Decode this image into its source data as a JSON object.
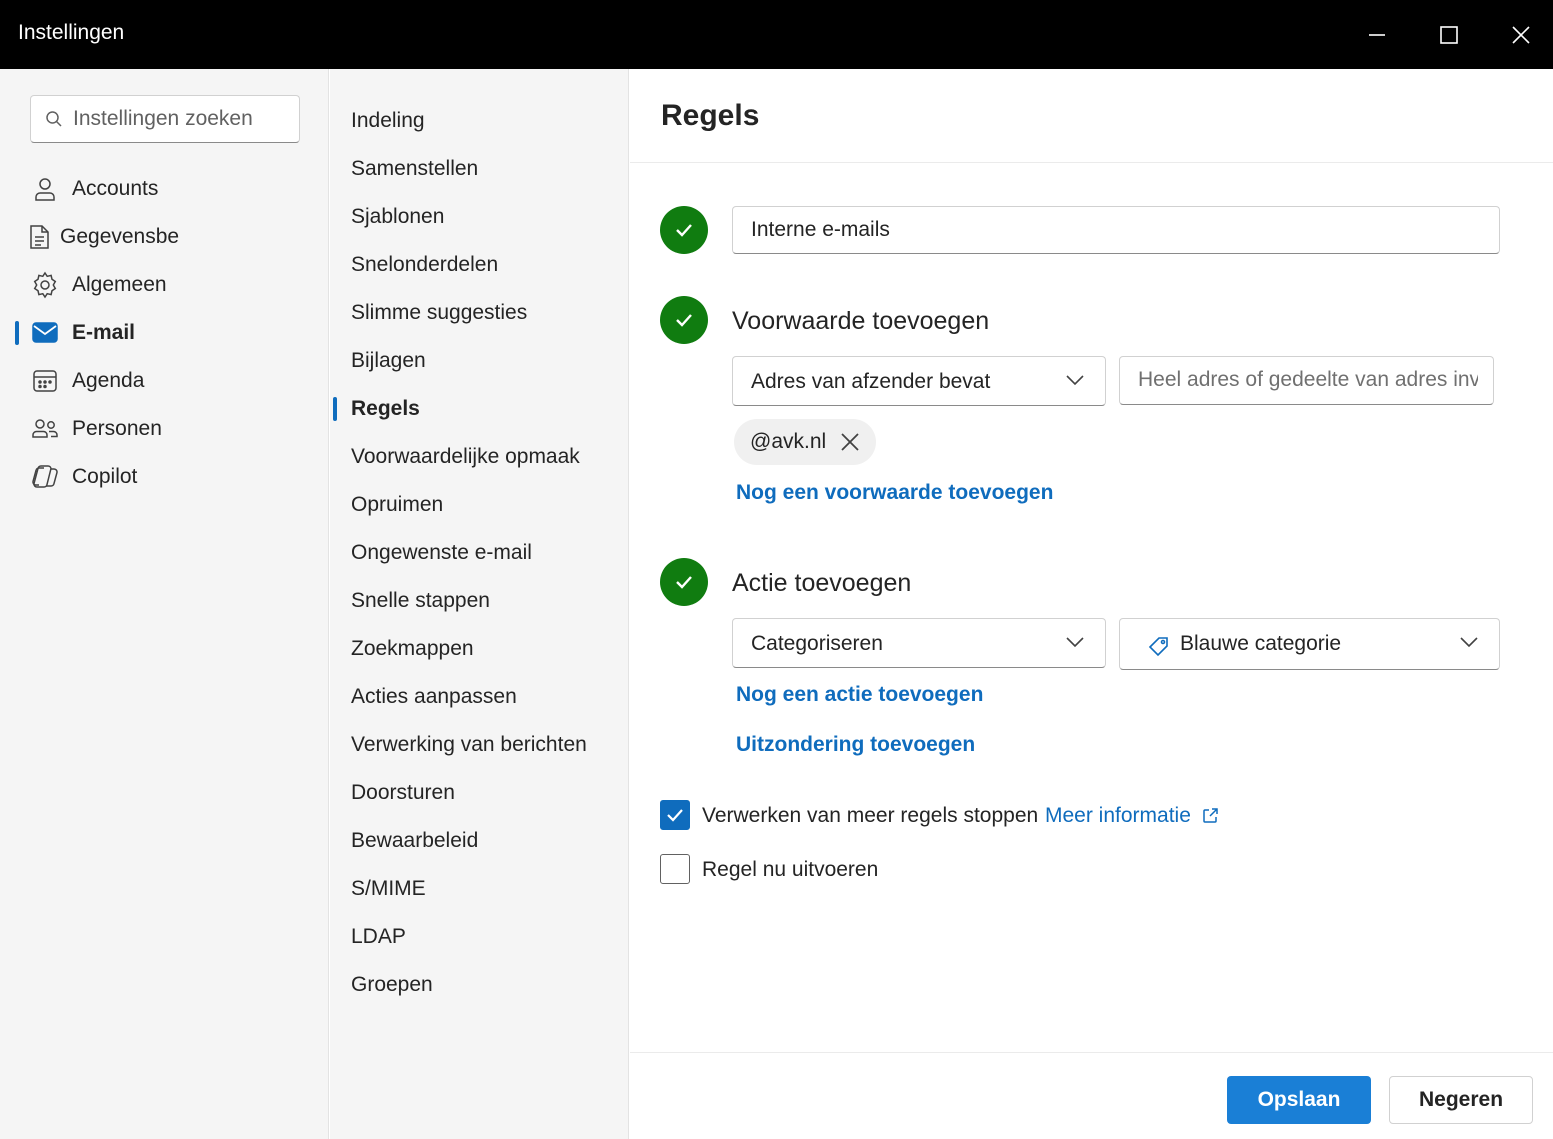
{
  "window": {
    "title": "Instellingen",
    "minimize_icon": "minimize-icon",
    "maximize_icon": "maximize-icon",
    "close_icon": "close-icon"
  },
  "search": {
    "placeholder": "Instellingen zoeken",
    "icon": "search-icon"
  },
  "nav": {
    "items": [
      {
        "label": "Accounts",
        "icon": "person-icon"
      },
      {
        "label": "Gegevensbe",
        "icon": "document-icon"
      },
      {
        "label": "Algemeen",
        "icon": "gear-icon"
      },
      {
        "label": "E-mail",
        "icon": "mail-icon",
        "selected": true
      },
      {
        "label": "Agenda",
        "icon": "calendar-icon"
      },
      {
        "label": "Personen",
        "icon": "people-icon"
      },
      {
        "label": "Copilot",
        "icon": "copilot-icon"
      }
    ]
  },
  "submenu": {
    "items": [
      {
        "label": "Indeling"
      },
      {
        "label": "Samenstellen"
      },
      {
        "label": "Sjablonen"
      },
      {
        "label": "Snelonderdelen"
      },
      {
        "label": "Slimme suggesties"
      },
      {
        "label": "Bijlagen"
      },
      {
        "label": "Regels",
        "selected": true
      },
      {
        "label": "Voorwaardelijke opmaak"
      },
      {
        "label": "Opruimen"
      },
      {
        "label": "Ongewenste e-mail"
      },
      {
        "label": "Snelle stappen"
      },
      {
        "label": "Zoekmappen"
      },
      {
        "label": "Acties aanpassen"
      },
      {
        "label": "Verwerking van berichten"
      },
      {
        "label": "Doorsturen"
      },
      {
        "label": "Bewaarbeleid"
      },
      {
        "label": "S/MIME"
      },
      {
        "label": "LDAP"
      },
      {
        "label": "Groepen"
      }
    ]
  },
  "content": {
    "heading": "Regels",
    "rule_name": "Interne e-mails",
    "condition": {
      "title": "Voorwaarde toevoegen",
      "dropdown_value": "Adres van afzender bevat",
      "address_placeholder": "Heel adres of gedeelte van adres inv",
      "chip_value": "@avk.nl",
      "add_link": "Nog een voorwaarde toevoegen"
    },
    "action": {
      "title": "Actie toevoegen",
      "dropdown_value": "Categoriseren",
      "category_value": "Blauwe categorie",
      "category_icon": "tag-icon",
      "add_link": "Nog een actie toevoegen",
      "exception_link": "Uitzondering toevoegen"
    },
    "options": {
      "stop_processing_label": "Verwerken van meer regels stoppen",
      "stop_processing_checked": true,
      "more_info_link": "Meer informatie",
      "run_now_label": "Regel nu uitvoeren",
      "run_now_checked": false
    },
    "buttons": {
      "save": "Opslaan",
      "discard": "Negeren"
    }
  },
  "colors": {
    "accent": "#0f6cbd",
    "success": "#107c10",
    "titlebar": "#000000",
    "nav_background": "#f5f5f5"
  }
}
